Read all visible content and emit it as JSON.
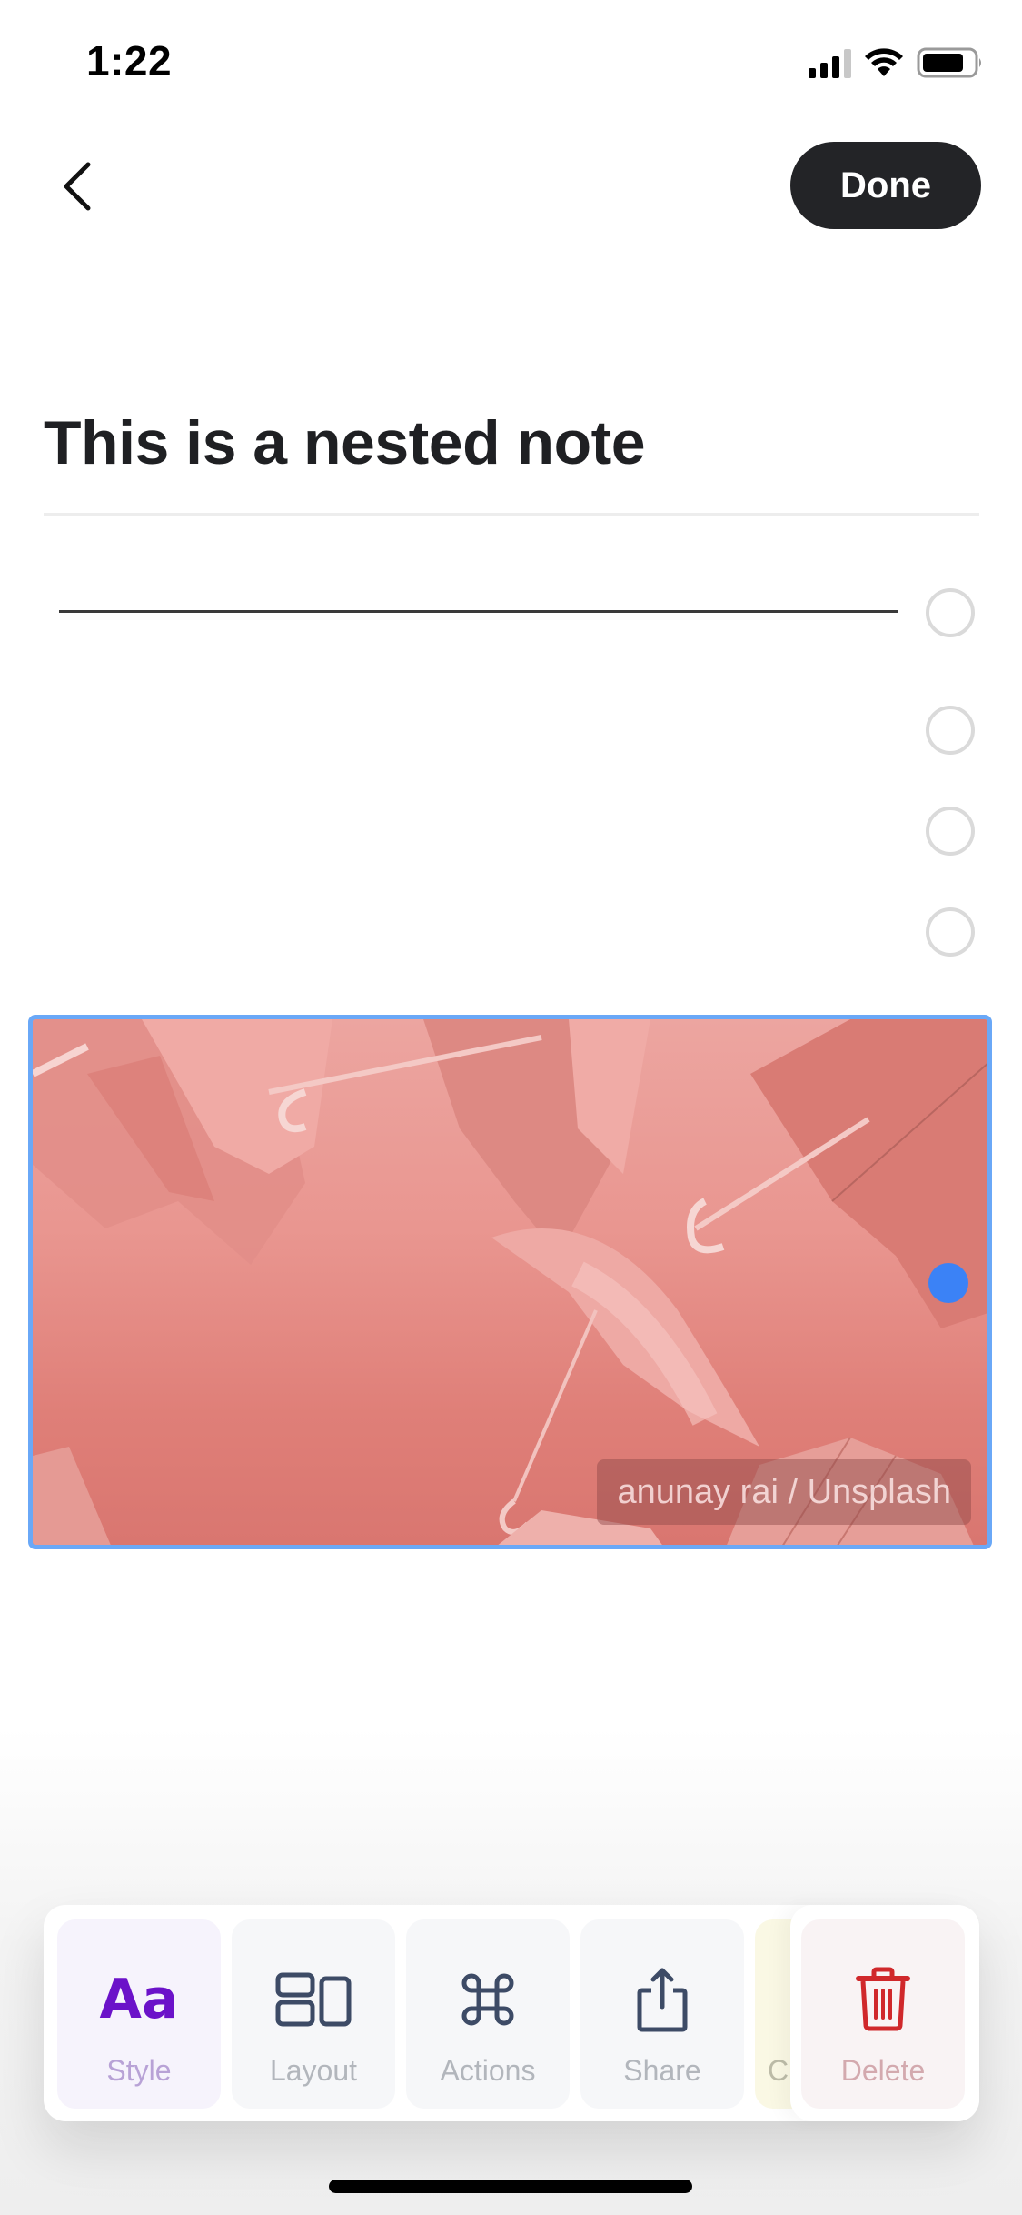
{
  "status_bar": {
    "time": "1:22",
    "signal_icon": "cellular-signal-icon",
    "wifi_icon": "wifi-icon",
    "battery_icon": "battery-icon"
  },
  "nav": {
    "back_icon": "chevron-left-icon",
    "done_label": "Done"
  },
  "note": {
    "title": "This is a nested note",
    "blocks": [
      {
        "type": "divider"
      },
      {
        "type": "empty"
      },
      {
        "type": "empty"
      },
      {
        "type": "empty"
      },
      {
        "type": "image",
        "caption": "anunay rai / Unsplash",
        "selected": true
      }
    ]
  },
  "colors": {
    "accent_selection": "#6aa8f7",
    "handle_active": "#3b82f6",
    "done_button": "#232427",
    "style_accent": "#6b12c9",
    "icon_dark": "#3d4b66",
    "delete_red": "#d0282b"
  },
  "toolbar": {
    "items": [
      {
        "label": "Style",
        "icon": "text-style-icon",
        "glyph": "Aa"
      },
      {
        "label": "Layout",
        "icon": "layout-icon"
      },
      {
        "label": "Actions",
        "icon": "command-icon"
      },
      {
        "label": "Share",
        "icon": "share-icon"
      },
      {
        "label": "C",
        "icon": "partially-hidden-item"
      },
      {
        "label": "Delete",
        "icon": "trash-icon"
      }
    ]
  }
}
